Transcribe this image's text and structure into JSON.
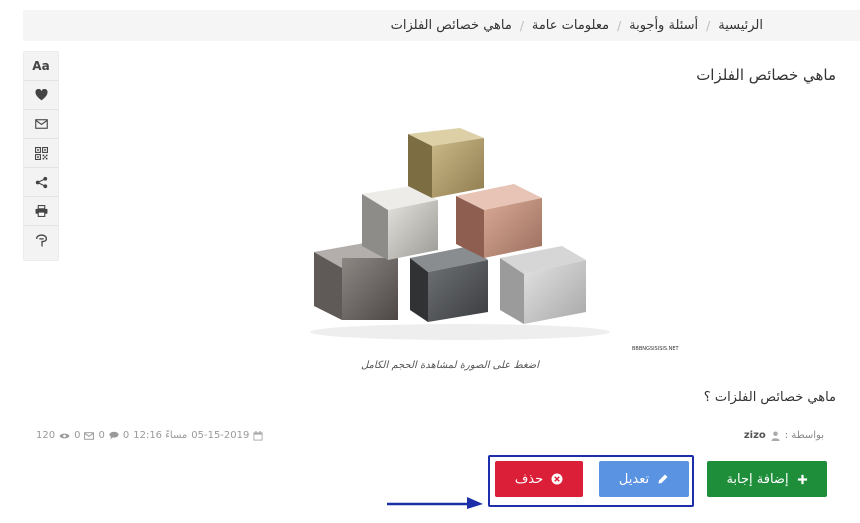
{
  "breadcrumb": {
    "items": [
      "الرئيسية",
      "أسئلة وأجوبة",
      "معلومات عامة",
      "ماهي خصائص الفلزات"
    ],
    "separator": "/"
  },
  "toolbar": {
    "items": [
      {
        "name": "font-size",
        "label": "Aa"
      },
      {
        "name": "favorite",
        "icon": "heart-icon"
      },
      {
        "name": "email",
        "icon": "envelope-icon"
      },
      {
        "name": "qrcode",
        "icon": "qrcode-icon"
      },
      {
        "name": "share",
        "icon": "share-icon"
      },
      {
        "name": "print",
        "icon": "print-icon"
      },
      {
        "name": "report",
        "icon": "flag-icon"
      }
    ]
  },
  "post": {
    "title": "ماهي خصائص الفلزات",
    "image_caption": "اضغط على الصورة لمشاهدة الحجم الكامل",
    "image_watermark": "BBBNGSISISIS.NET",
    "question": "ماهي خصائص الفلزات ؟",
    "author_label": "بواسطة :",
    "author_name": "zizo",
    "date": "05-15-2019",
    "time": "12:16 مساءً",
    "answers_count": "0",
    "emails_count": "0",
    "views_count": "0",
    "extra_count": "120"
  },
  "actions": {
    "add_answer": "إضافة إجابة",
    "edit": "تعديل",
    "delete": "حذف"
  },
  "colors": {
    "delete": "#dc1f38",
    "edit": "#5b93e3",
    "add": "#1f8e3a",
    "highlight": "#1c2fa8"
  }
}
